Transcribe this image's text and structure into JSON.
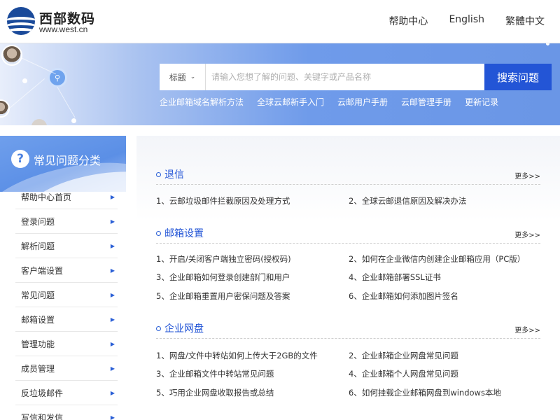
{
  "header": {
    "logo_name": "西部数码",
    "logo_url": "www.west.cn",
    "nav": [
      "帮助中心",
      "English",
      "繁體中文"
    ]
  },
  "banner": {
    "search_select": "标题",
    "search_placeholder": "请输入您想了解的问题、关键字或产品名称",
    "search_button": "搜索问题",
    "quick_links": [
      "企业邮箱域名解析方法",
      "全球云邮新手入门",
      "云邮用户手册",
      "云邮管理手册",
      "更新记录"
    ]
  },
  "sidebar": {
    "title": "常见问题分类",
    "items": [
      "帮助中心首页",
      "登录问题",
      "解析问题",
      "客户端设置",
      "常见问题",
      "邮箱设置",
      "管理功能",
      "成员管理",
      "反垃圾邮件",
      "写信和发信"
    ]
  },
  "sections": [
    {
      "title": "退信",
      "more": "更多>>",
      "links": [
        "1、云邮垃圾邮件拦截原因及处理方式",
        "2、全球云邮退信原因及解决办法"
      ]
    },
    {
      "title": "邮箱设置",
      "more": "更多>>",
      "links": [
        "1、开启/关闭客户端独立密码(授权码)",
        "2、如何在企业微信内创建企业邮箱应用（PC版）",
        "3、企业邮箱如何登录创建部门和用户",
        "4、企业邮箱部署SSL证书",
        "5、企业邮箱重置用户密保问题及答案",
        "6、企业邮箱如何添加图片签名"
      ]
    },
    {
      "title": "企业网盘",
      "more": "更多>>",
      "links": [
        "1、网盘/文件中转站如何上传大于2GB的文件",
        "2、企业邮箱企业网盘常见问题",
        "3、企业邮箱文件中转站常见问题",
        "4、企业邮箱个人网盘常见问题",
        "5、巧用企业网盘收取报告或总结",
        "6、如何挂载企业邮箱网盘到windows本地"
      ]
    }
  ],
  "colors": {
    "accent": "#2355d6",
    "banner_blue": "#6a96e6"
  }
}
